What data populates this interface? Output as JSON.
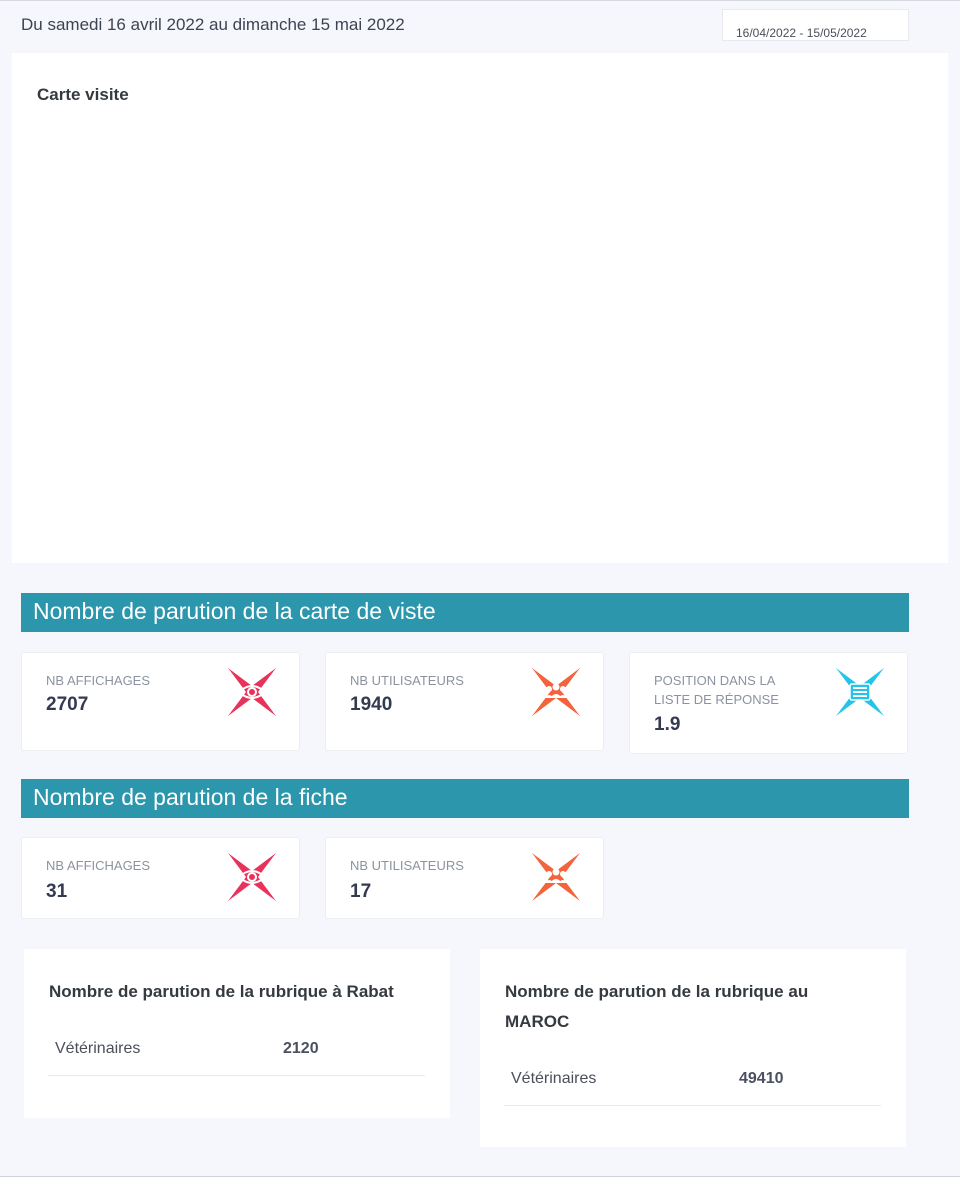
{
  "header": {
    "period_text": "Du samedi 16 avril 2022 au dimanche 15 mai 2022",
    "date_range": "16/04/2022 - 15/05/2022"
  },
  "carte_visite": {
    "title": "Carte visite"
  },
  "section_carte": {
    "title": "Nombre de parution de la carte de viste",
    "stats": [
      {
        "label": "NB AFFICHAGES",
        "value": "2707",
        "icon": "eye-icon",
        "color": "#e8325a"
      },
      {
        "label": "NB UTILISATEURS",
        "value": "1940",
        "icon": "users-icon",
        "color": "#f2633e"
      },
      {
        "label": "POSITION DANS LA LISTE DE RÉPONSE",
        "value": "1.9",
        "icon": "list-icon",
        "color": "#22c5e8"
      }
    ]
  },
  "section_fiche": {
    "title": "Nombre de parution de la fiche",
    "stats": [
      {
        "label": "NB AFFICHAGES",
        "value": "31",
        "icon": "eye-icon",
        "color": "#e8325a"
      },
      {
        "label": "NB UTILISATEURS",
        "value": "17",
        "icon": "users-icon",
        "color": "#f2633e"
      }
    ]
  },
  "rubrique_rabat": {
    "title": "Nombre de parution de la rubrique à Rabat",
    "rows": [
      {
        "name": "Vétérinaires",
        "value": "2120"
      }
    ]
  },
  "rubrique_maroc": {
    "title": "Nombre de parution de la rubrique au MAROC",
    "rows": [
      {
        "name": "Vétérinaires",
        "value": "49410"
      }
    ]
  }
}
